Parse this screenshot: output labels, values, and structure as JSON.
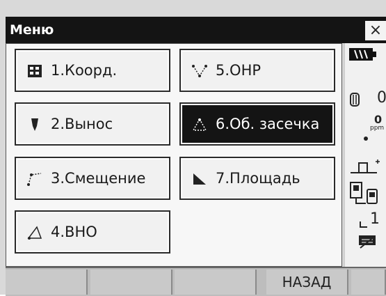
{
  "window": {
    "title": "Меню",
    "close_glyph": "×"
  },
  "menu": {
    "items": [
      {
        "label": "1.Коорд.",
        "icon": "coordinates-icon",
        "selected": false
      },
      {
        "label": "2.Вынос",
        "icon": "stakeout-icon",
        "selected": false
      },
      {
        "label": "3.Смещение",
        "icon": "offset-icon",
        "selected": false
      },
      {
        "label": "4.ВНО",
        "icon": "remote-elevation-icon",
        "selected": false
      },
      {
        "label": "5.ОНР",
        "icon": "missing-line-icon",
        "selected": false
      },
      {
        "label": "6.Об. засечка",
        "icon": "resection-icon",
        "selected": true
      },
      {
        "label": "7.Площадь",
        "icon": "area-icon",
        "selected": false
      }
    ]
  },
  "status": {
    "ppm_value": "0",
    "ppm_unit": "ppm",
    "zero_value": "0",
    "page_number": "1"
  },
  "softkeys": [
    "",
    "",
    "",
    "НАЗАД",
    ""
  ],
  "colors": {
    "title_bg": "#141414",
    "selected_bg": "#141414",
    "button_bg": "#f1f1f1"
  }
}
